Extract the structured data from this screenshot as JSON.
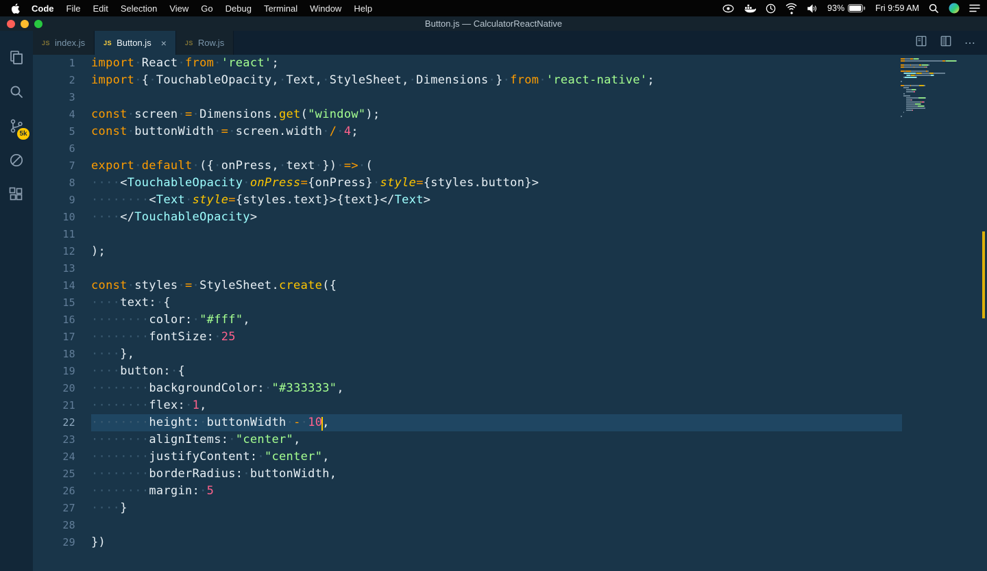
{
  "menubar": {
    "items": [
      {
        "label": "Code",
        "bold": true
      },
      {
        "label": "File"
      },
      {
        "label": "Edit"
      },
      {
        "label": "Selection"
      },
      {
        "label": "View"
      },
      {
        "label": "Go"
      },
      {
        "label": "Debug"
      },
      {
        "label": "Terminal"
      },
      {
        "label": "Window"
      },
      {
        "label": "Help"
      }
    ],
    "battery_percent": "93%",
    "clock": "Fri 9:59 AM",
    "status_icons": [
      "eye",
      "docker",
      "time-machine",
      "wifi",
      "volume",
      "battery",
      "spotlight",
      "profile",
      "notification-center"
    ]
  },
  "window": {
    "title": "Button.js — CalculatorReactNative"
  },
  "activity_bar": {
    "scm_badge": "5k",
    "icons": [
      "explorer",
      "search",
      "source-control",
      "debug-disabled",
      "extensions"
    ]
  },
  "tab_bar": {
    "tabs": [
      {
        "label": "index.js",
        "icon": "JS",
        "active": false
      },
      {
        "label": "Button.js",
        "icon": "JS",
        "active": true,
        "close": "×"
      },
      {
        "label": "Row.js",
        "icon": "JS",
        "active": false
      }
    ],
    "actions": [
      "split-editor",
      "editor-layout",
      "more-actions"
    ]
  },
  "colors": {
    "editor_background": "#193549",
    "active_line": "#1f4662",
    "keyword": "#ff9d00",
    "string": "#a5ff90",
    "number": "#ff628c",
    "function": "#ffc600",
    "jsx_tag": "#9effff",
    "badge": "#ffc600"
  },
  "editor": {
    "active_line": 22,
    "lines": [
      [
        [
          "kw",
          "import"
        ],
        [
          "pl",
          " React "
        ],
        [
          "kw",
          "from"
        ],
        [
          "pl",
          " "
        ],
        [
          "str",
          "'react'"
        ],
        [
          "pl",
          ";"
        ]
      ],
      [
        [
          "kw",
          "import"
        ],
        [
          "pl",
          " { TouchableOpacity, Text, StyleSheet, Dimensions } "
        ],
        [
          "kw",
          "from"
        ],
        [
          "pl",
          " "
        ],
        [
          "str",
          "'react-native'"
        ],
        [
          "pl",
          ";"
        ]
      ],
      [],
      [
        [
          "kw",
          "const"
        ],
        [
          "pl",
          " screen "
        ],
        [
          "op",
          "="
        ],
        [
          "pl",
          " Dimensions."
        ],
        [
          "fn",
          "get"
        ],
        [
          "pl",
          "("
        ],
        [
          "str",
          "\"window\""
        ],
        [
          "pl",
          ");"
        ]
      ],
      [
        [
          "kw",
          "const"
        ],
        [
          "pl",
          " buttonWidth "
        ],
        [
          "op",
          "="
        ],
        [
          "pl",
          " screen.width "
        ],
        [
          "op",
          "/"
        ],
        [
          "pl",
          " "
        ],
        [
          "num",
          "4"
        ],
        [
          "pl",
          ";"
        ]
      ],
      [],
      [
        [
          "kw",
          "export"
        ],
        [
          "pl",
          " "
        ],
        [
          "kw",
          "default"
        ],
        [
          "pl",
          " ({ onPress, text }) "
        ],
        [
          "op",
          "=>"
        ],
        [
          "pl",
          " ("
        ]
      ],
      [
        [
          "ws",
          "    "
        ],
        [
          "pl",
          "<"
        ],
        [
          "tag",
          "TouchableOpacity"
        ],
        [
          "pl",
          " "
        ],
        [
          "attr",
          "onPress"
        ],
        [
          "op",
          "="
        ],
        [
          "pl",
          "{onPress} "
        ],
        [
          "attr",
          "style"
        ],
        [
          "op",
          "="
        ],
        [
          "pl",
          "{styles.button}>"
        ]
      ],
      [
        [
          "ws",
          "        "
        ],
        [
          "pl",
          "<"
        ],
        [
          "tag",
          "Text"
        ],
        [
          "pl",
          " "
        ],
        [
          "attr",
          "style"
        ],
        [
          "op",
          "="
        ],
        [
          "pl",
          "{styles.text}>{text}</"
        ],
        [
          "tag",
          "Text"
        ],
        [
          "pl",
          ">"
        ]
      ],
      [
        [
          "ws",
          "    "
        ],
        [
          "pl",
          "</"
        ],
        [
          "tag",
          "TouchableOpacity"
        ],
        [
          "pl",
          ">"
        ]
      ],
      [],
      [
        [
          "pl",
          ");"
        ]
      ],
      [],
      [
        [
          "kw",
          "const"
        ],
        [
          "pl",
          " styles "
        ],
        [
          "op",
          "="
        ],
        [
          "pl",
          " StyleSheet."
        ],
        [
          "fn",
          "create"
        ],
        [
          "pl",
          "({"
        ]
      ],
      [
        [
          "ws",
          "    "
        ],
        [
          "pl",
          "text: {"
        ]
      ],
      [
        [
          "ws",
          "        "
        ],
        [
          "pl",
          "color: "
        ],
        [
          "str",
          "\"#fff\""
        ],
        [
          "pl",
          ","
        ]
      ],
      [
        [
          "ws",
          "        "
        ],
        [
          "pl",
          "fontSize: "
        ],
        [
          "num",
          "25"
        ]
      ],
      [
        [
          "ws",
          "    "
        ],
        [
          "pl",
          "},"
        ]
      ],
      [
        [
          "ws",
          "    "
        ],
        [
          "pl",
          "button: {"
        ]
      ],
      [
        [
          "ws",
          "        "
        ],
        [
          "pl",
          "backgroundColor: "
        ],
        [
          "str",
          "\"#333333\""
        ],
        [
          "pl",
          ","
        ]
      ],
      [
        [
          "ws",
          "        "
        ],
        [
          "pl",
          "flex: "
        ],
        [
          "num",
          "1"
        ],
        [
          "pl",
          ","
        ]
      ],
      [
        [
          "ws",
          "        "
        ],
        [
          "pl",
          "height: buttonWidth "
        ],
        [
          "op",
          "-"
        ],
        [
          "pl",
          " "
        ],
        [
          "num",
          "10"
        ],
        [
          "caret",
          ""
        ],
        [
          "pl",
          ","
        ]
      ],
      [
        [
          "ws",
          "        "
        ],
        [
          "pl",
          "alignItems: "
        ],
        [
          "str",
          "\"center\""
        ],
        [
          "pl",
          ","
        ]
      ],
      [
        [
          "ws",
          "        "
        ],
        [
          "pl",
          "justifyContent: "
        ],
        [
          "str",
          "\"center\""
        ],
        [
          "pl",
          ","
        ]
      ],
      [
        [
          "ws",
          "        "
        ],
        [
          "pl",
          "borderRadius: buttonWidth,"
        ]
      ],
      [
        [
          "ws",
          "        "
        ],
        [
          "pl",
          "margin: "
        ],
        [
          "num",
          "5"
        ]
      ],
      [
        [
          "ws",
          "    "
        ],
        [
          "pl",
          "}"
        ]
      ],
      [],
      [
        [
          "pl",
          "})"
        ]
      ]
    ]
  }
}
